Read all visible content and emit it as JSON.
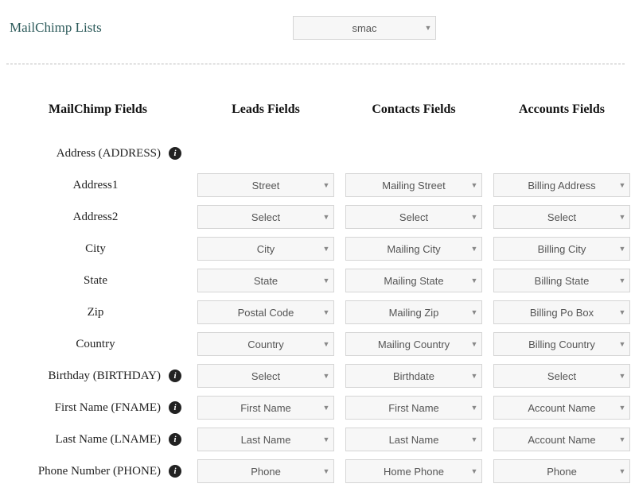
{
  "top": {
    "label": "MailChimp Lists",
    "select_value": "smac"
  },
  "headers": {
    "mailchimp": "MailChimp Fields",
    "leads": "Leads Fields",
    "contacts": "Contacts Fields",
    "accounts": "Accounts Fields"
  },
  "rows": [
    {
      "label": "Address (ADDRESS)",
      "info": true,
      "leads": null,
      "contacts": null,
      "accounts": null,
      "indent": false
    },
    {
      "label": "Address1",
      "info": false,
      "leads": "Street",
      "contacts": "Mailing Street",
      "accounts": "Billing Address",
      "indent": true
    },
    {
      "label": "Address2",
      "info": false,
      "leads": "Select",
      "contacts": "Select",
      "accounts": "Select",
      "indent": true
    },
    {
      "label": "City",
      "info": false,
      "leads": "City",
      "contacts": "Mailing City",
      "accounts": "Billing City",
      "indent": true
    },
    {
      "label": "State",
      "info": false,
      "leads": "State",
      "contacts": "Mailing State",
      "accounts": "Billing State",
      "indent": true
    },
    {
      "label": "Zip",
      "info": false,
      "leads": "Postal Code",
      "contacts": "Mailing Zip",
      "accounts": "Billing Po Box",
      "indent": true
    },
    {
      "label": "Country",
      "info": false,
      "leads": "Country",
      "contacts": "Mailing Country",
      "accounts": "Billing Country",
      "indent": true
    },
    {
      "label": "Birthday (BIRTHDAY)",
      "info": true,
      "leads": "Select",
      "contacts": "Birthdate",
      "accounts": "Select",
      "indent": false
    },
    {
      "label": "First Name (FNAME)",
      "info": true,
      "leads": "First Name",
      "contacts": "First Name",
      "accounts": "Account Name",
      "indent": false
    },
    {
      "label": "Last Name (LNAME)",
      "info": true,
      "leads": "Last Name",
      "contacts": "Last Name",
      "accounts": "Account Name",
      "indent": false
    },
    {
      "label": "Phone Number (PHONE)",
      "info": true,
      "leads": "Phone",
      "contacts": "Home Phone",
      "accounts": "Phone",
      "indent": false
    }
  ]
}
